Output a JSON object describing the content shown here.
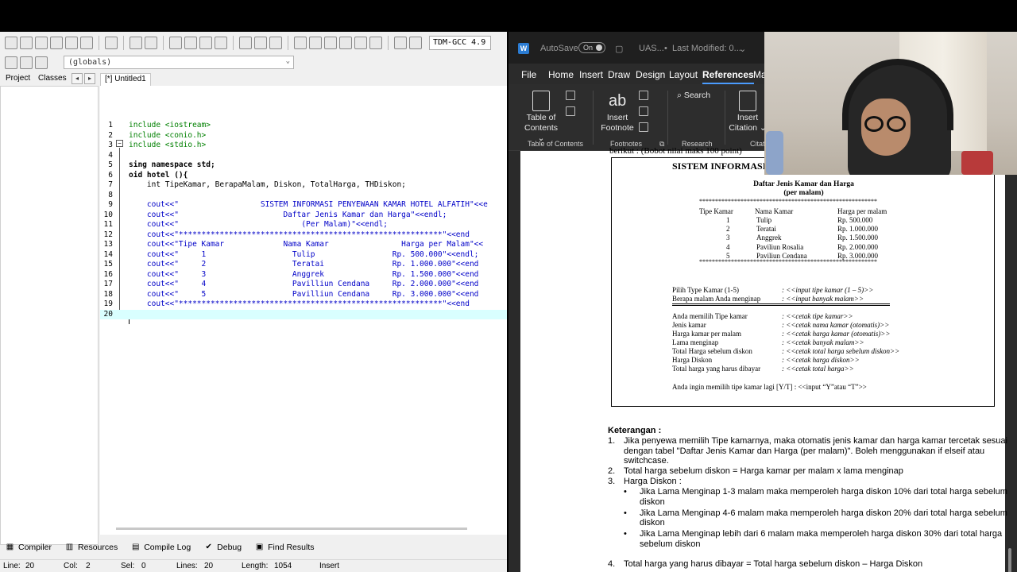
{
  "ide": {
    "compiler": "TDM-GCC 4.9",
    "globals": "(globals)",
    "panel_tabs": [
      "Project",
      "Classes"
    ],
    "file_tab": "[*] Untitled1",
    "code": [
      {
        "n": "1",
        "t": "include <iostream>"
      },
      {
        "n": "2",
        "t": "include <conio.h>"
      },
      {
        "n": "3",
        "t": "include <stdio.h>"
      },
      {
        "n": "4",
        "t": ""
      },
      {
        "n": "5",
        "t": "sing namespace std;"
      },
      {
        "n": "6",
        "t": "oid hotel (){"
      },
      {
        "n": "7",
        "t": "    int TipeKamar, BerapaMalam, Diskon, TotalHarga, THDiskon;"
      },
      {
        "n": "8",
        "t": ""
      },
      {
        "n": "9",
        "t": "    cout<<\"                  SISTEM INFORMASI PENYEWAAN KAMAR HOTEL ALFATIH\"<<e"
      },
      {
        "n": "10",
        "t": "    cout<<\"                       Daftar Jenis Kamar dan Harga\"<<endl;"
      },
      {
        "n": "11",
        "t": "    cout<<\"                           (Per Malam)\"<<endl;"
      },
      {
        "n": "12",
        "t": "    cout<<\"**********************************************************\"<<end"
      },
      {
        "n": "13",
        "t": "    cout<<\"Tipe Kamar             Nama Kamar                Harga per Malam\"<<"
      },
      {
        "n": "14",
        "t": "    cout<<\"     1                   Tulip                 Rp. 500.000\"<<endl;"
      },
      {
        "n": "15",
        "t": "    cout<<\"     2                   Teratai               Rp. 1.000.000\"<<end"
      },
      {
        "n": "16",
        "t": "    cout<<\"     3                   Anggrek               Rp. 1.500.000\"<<end"
      },
      {
        "n": "17",
        "t": "    cout<<\"     4                   Pavilliun Cendana     Rp. 2.000.000\"<<end"
      },
      {
        "n": "18",
        "t": "    cout<<\"     5                   Pavilliun Cendana     Rp. 3.000.000\"<<end"
      },
      {
        "n": "19",
        "t": "    cout<<\"**********************************************************\"<<end"
      },
      {
        "n": "20",
        "t": ""
      }
    ],
    "bottom_tabs": [
      {
        "icon": "▦",
        "label": "Compiler"
      },
      {
        "icon": "▥",
        "label": "Resources"
      },
      {
        "icon": "▤",
        "label": "Compile Log"
      },
      {
        "icon": "✔",
        "label": "Debug"
      },
      {
        "icon": "▣",
        "label": "Find Results"
      }
    ],
    "status": {
      "line_label": "Line:",
      "line": "20",
      "col_label": "Col:",
      "col": "2",
      "sel_label": "Sel:",
      "sel": "0",
      "lines_label": "Lines:",
      "lines": "20",
      "length_label": "Length:",
      "length": "1054",
      "mode": "Insert"
    }
  },
  "word": {
    "autosave": "AutoSave",
    "toggle": "On",
    "doc_name": "UAS...",
    "modified": "Last Modified: 0...",
    "menus": [
      "File",
      "Home",
      "Insert",
      "Draw",
      "Design",
      "Layout",
      "References",
      "Ma"
    ],
    "active_menu": "References",
    "ribbon": {
      "toc_1": "Table of",
      "toc_2": "Contents ⌄",
      "footnote_1": "Insert",
      "footnote_2": "Footnote",
      "search": "Search",
      "citation_1": "Insert",
      "citation_2": "Citation ⌄",
      "groups": [
        "Table of Contents",
        "Footnotes",
        "Research",
        "Citati"
      ]
    },
    "doc": {
      "top_cut": "berikut : (Bobot nilai maks 100 point)",
      "box_title": "SISTEM INFORMASI PE",
      "box_sub1": "Daftar Jenis Kamar dan Harga",
      "box_sub2": "(per malam)",
      "stars": "********************************************************",
      "headers": [
        "Tipe Kamar",
        "Nama Kamar",
        "Harga per malam"
      ],
      "rows": [
        [
          "1",
          "Tulip",
          "Rp. 500.000"
        ],
        [
          "2",
          "Teratai",
          "Rp. 1.000.000"
        ],
        [
          "3",
          "Anggrek",
          "Rp. 1.500.000"
        ],
        [
          "4",
          "Paviliun Rosalia",
          "Rp. 2.000.000"
        ],
        [
          "5",
          "Paviliun Cendana",
          "Rp. 3.000.000"
        ]
      ],
      "inputs": [
        [
          "Pilih Type Kamar (1-5)",
          ": <<input tipe kamar (1 – 5)>>"
        ],
        [
          "Berapa malam Anda menginap",
          ": <<input banyak malam>>"
        ]
      ],
      "outputs": [
        [
          "Anda memilih Tipe kamar",
          ": <<cetak tipe kamar>>"
        ],
        [
          "Jenis kamar",
          ": <<cetak nama kamar (otomatis)>>"
        ],
        [
          "Harga kamar per malam",
          ": <<cetak harga kamar (otomatis)>>"
        ],
        [
          "Lama menginap",
          ": <<cetak banyak malam>>"
        ],
        [
          "Total Harga sebelum diskon",
          ": <<cetak total harga sebelum diskon>>"
        ],
        [
          "Harga Diskon",
          ": <<cetak harga diskon>>"
        ],
        [
          "Total harga yang harus dibayar",
          ": <<cetak total harga>>"
        ]
      ],
      "again": "Anda ingin memilih tipe kamar lagi [Y/T] : <<input “Y”atau “T”>>",
      "ket_title": "Keterangan :",
      "ket1_num": "1.",
      "ket1": "Jika penyewa memilih Tipe kamarnya, maka otomatis jenis kamar dan harga kamar tercetak sesuai dengan tabel \"Daftar Jenis Kamar dan Harga (per malam)\". Boleh menggunakan if elseif atau switchcase.",
      "ket2_num": "2.",
      "ket2": "Total harga sebelum diskon = Harga kamar per malam x lama menginap",
      "ket3_num": "3.",
      "ket3": "Harga Diskon :",
      "bullet_sym": "•",
      "bullets": [
        "Jika Lama Menginap 1-3 malam maka memperoleh harga diskon 10% dari total harga sebelum diskon",
        "Jika Lama Menginap 4-6 malam maka memperoleh harga diskon 20% dari total harga sebelum diskon",
        "Jika Lama Menginap lebih dari 6 malam maka memperoleh harga diskon 30% dari total harga sebelum diskon"
      ],
      "ket4_num": "4.",
      "ket4": "Total harga yang harus dibayar = Total harga sebelum diskon – Harga Diskon"
    }
  }
}
